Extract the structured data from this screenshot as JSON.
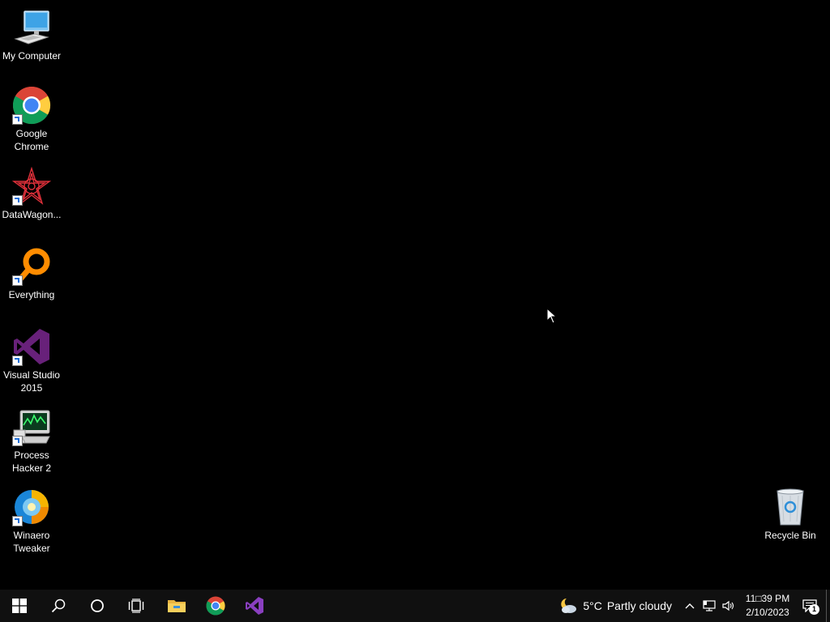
{
  "desktop": {
    "icons": [
      {
        "label": "My Computer",
        "icon": "computer-icon"
      },
      {
        "label": "Google\nChrome",
        "icon": "chrome-icon"
      },
      {
        "label": "DataWagon...",
        "icon": "datawagon-icon"
      },
      {
        "label": "Everything",
        "icon": "everything-search-icon"
      },
      {
        "label": "Visual Studio\n2015",
        "icon": "visual-studio-icon"
      },
      {
        "label": "Process\nHacker 2",
        "icon": "process-hacker-icon"
      },
      {
        "label": "Winaero\nTweaker",
        "icon": "winaero-tweaker-icon"
      },
      {
        "label": "Recycle Bin",
        "icon": "recycle-bin-icon"
      }
    ],
    "background_color": "#000000"
  },
  "taskbar": {
    "buttons": [
      {
        "name": "Start",
        "icon": "windows-start-icon"
      },
      {
        "name": "Search",
        "icon": "search-icon"
      },
      {
        "name": "Cortana",
        "icon": "cortana-circle-icon"
      },
      {
        "name": "Task View",
        "icon": "task-view-icon"
      },
      {
        "name": "File Explorer",
        "icon": "folder-icon"
      },
      {
        "name": "Google Chrome",
        "icon": "chrome-icon"
      },
      {
        "name": "Visual Studio",
        "icon": "visual-studio-icon"
      }
    ],
    "weather": {
      "temperature": "5°C",
      "condition": "Partly cloudy",
      "icon": "partly-cloudy-night-icon"
    },
    "clock": {
      "time": "11□39 PM",
      "date": "2/10/2023"
    },
    "notification_count": "1",
    "background_color": "#101010"
  }
}
